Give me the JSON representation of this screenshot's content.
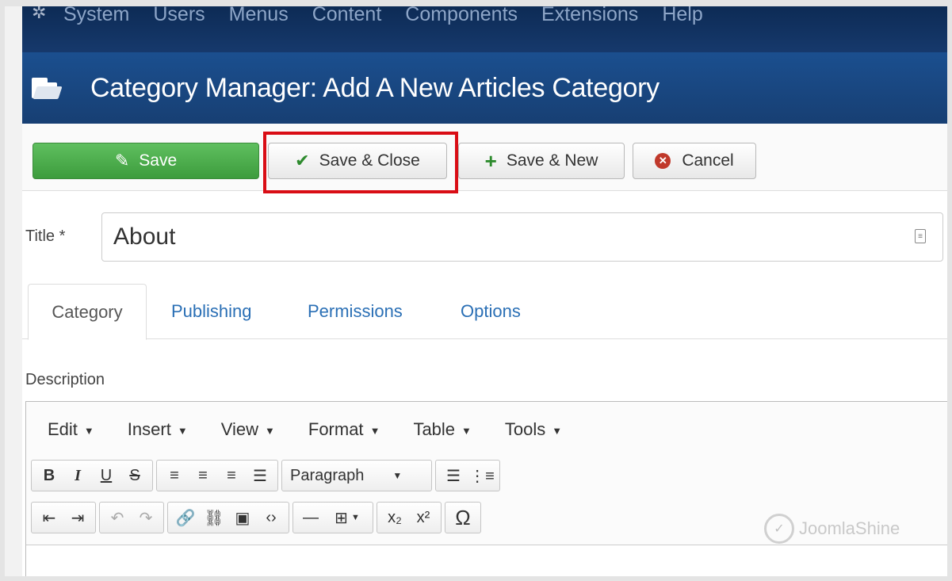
{
  "nav": {
    "items": [
      "System",
      "Users",
      "Menus",
      "Content",
      "Components",
      "Extensions",
      "Help"
    ]
  },
  "page": {
    "title": "Category Manager: Add A New Articles Category"
  },
  "toolbar": {
    "save_label": "Save",
    "save_close_label": "Save & Close",
    "save_new_label": "Save & New",
    "cancel_label": "Cancel"
  },
  "form": {
    "title_label": "Title *",
    "title_value": "About",
    "description_label": "Description"
  },
  "tabs": [
    "Category",
    "Publishing",
    "Permissions",
    "Options"
  ],
  "editor": {
    "menus": [
      "Edit",
      "Insert",
      "View",
      "Format",
      "Table",
      "Tools"
    ],
    "paragraph_select": "Paragraph"
  },
  "watermark": "JoomlaShine",
  "colors": {
    "nav_bg": "#0d2b55",
    "title_bg": "#1a4d8c",
    "save_green": "#46a546",
    "highlight_red": "#d90d15",
    "tab_link": "#2a6fb5"
  }
}
